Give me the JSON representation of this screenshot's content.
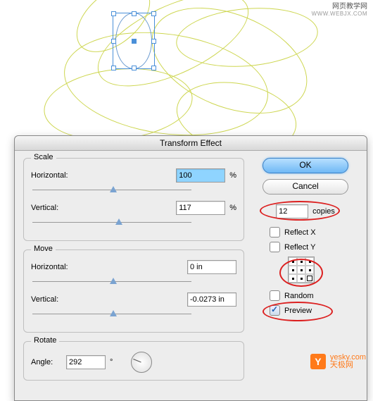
{
  "watermark_top": {
    "cn": "网页教学网",
    "en": "WWW.WEBJX.COM"
  },
  "dialog": {
    "title": "Transform Effect",
    "scale": {
      "legend": "Scale",
      "h_label": "Horizontal:",
      "h_value": "100",
      "h_unit": "%",
      "v_label": "Vertical:",
      "v_value": "117",
      "v_unit": "%"
    },
    "move": {
      "legend": "Move",
      "h_label": "Horizontal:",
      "h_value": "0 in",
      "v_label": "Vertical:",
      "v_value": "-0.0273 in"
    },
    "rotate": {
      "legend": "Rotate",
      "a_label": "Angle:",
      "a_value": "292",
      "a_unit": "°"
    },
    "ok": "OK",
    "cancel": "Cancel",
    "copies_value": "12",
    "copies_label": "copies",
    "reflect_x": "Reflect X",
    "reflect_y": "Reflect Y",
    "random": "Random",
    "preview": "Preview"
  },
  "watermark_bottom": {
    "logo": "Y",
    "line1": "yesky.com",
    "line2": "天极网"
  }
}
